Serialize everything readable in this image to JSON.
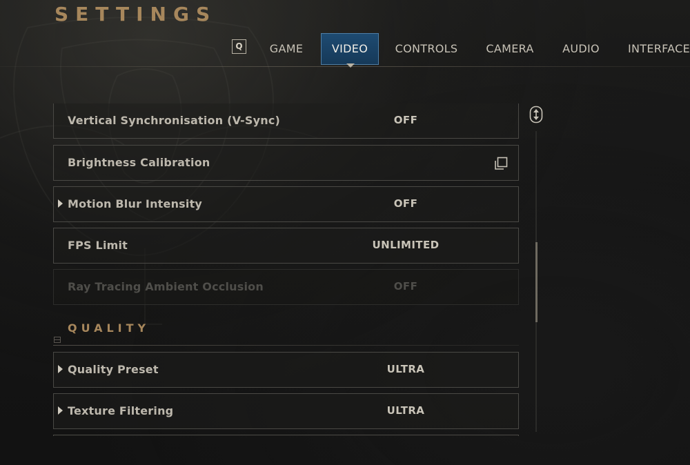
{
  "header": {
    "title": "SETTINGS"
  },
  "tabs": {
    "key_hint": "Q",
    "items": [
      {
        "label": "GAME"
      },
      {
        "label": "VIDEO",
        "active": true
      },
      {
        "label": "CONTROLS"
      },
      {
        "label": "CAMERA"
      },
      {
        "label": "AUDIO"
      },
      {
        "label": "INTERFACE"
      }
    ]
  },
  "settings": {
    "rows": [
      {
        "label": "Vertical Synchronisation (V-Sync)",
        "value": "OFF",
        "expandable": false,
        "disabled": false
      },
      {
        "label": "Brightness Calibration",
        "value": "",
        "expandable": false,
        "disabled": false,
        "icon": "external-link-icon"
      },
      {
        "label": "Motion Blur Intensity",
        "value": "OFF",
        "expandable": true,
        "disabled": false
      },
      {
        "label": "FPS Limit",
        "value": "UNLIMITED",
        "expandable": false,
        "disabled": false
      },
      {
        "label": "Ray Tracing Ambient Occlusion",
        "value": "OFF",
        "expandable": false,
        "disabled": true
      }
    ],
    "quality_section_title": "QUALITY",
    "quality_rows": [
      {
        "label": "Quality Preset",
        "value": "ULTRA",
        "expandable": true,
        "disabled": false
      },
      {
        "label": "Texture Filtering",
        "value": "ULTRA",
        "expandable": true,
        "disabled": false
      }
    ]
  },
  "colors": {
    "accent_gold": "#a7875c",
    "active_tab_blue": "#1e4b72",
    "row_border": "#4a4945"
  },
  "scrollbar": {
    "position_fraction": 0.37
  }
}
